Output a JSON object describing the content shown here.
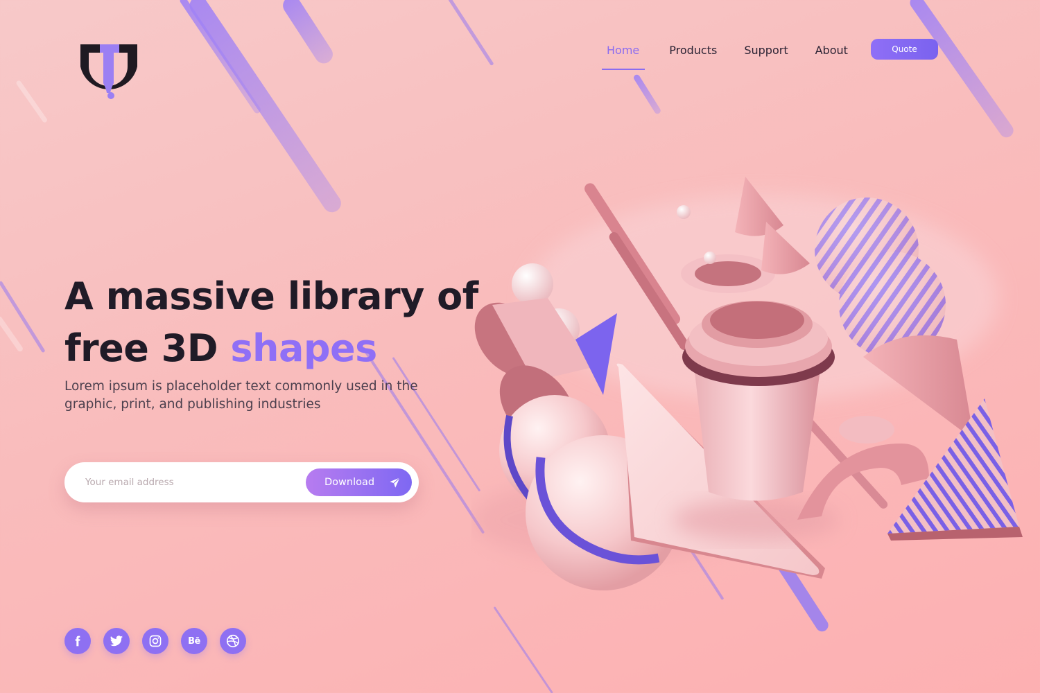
{
  "brand": {
    "logo_icon": "brand-logo-icon",
    "colors": {
      "accent": "#8f6ff6",
      "dark": "#201b27",
      "background": "#f9bcbc"
    }
  },
  "nav": {
    "items": [
      {
        "label": "Home",
        "active": true
      },
      {
        "label": "Products",
        "active": false
      },
      {
        "label": "Support",
        "active": false
      },
      {
        "label": "About",
        "active": false
      }
    ],
    "cta_label": "Quote"
  },
  "hero": {
    "headline_line1": "A massive library of",
    "headline_line2_plain": "free 3D ",
    "headline_line2_accent": "shapes",
    "subtext": "Lorem ipsum is placeholder text commonly used in the graphic, print, and publishing industries"
  },
  "signup": {
    "email_placeholder": "Your email address",
    "email_value": "",
    "download_label": "Download",
    "button_icon": "paper-plane-icon"
  },
  "social": [
    {
      "name": "facebook",
      "icon": "facebook-icon"
    },
    {
      "name": "twitter",
      "icon": "twitter-icon"
    },
    {
      "name": "instagram",
      "icon": "instagram-icon"
    },
    {
      "name": "behance",
      "icon": "behance-icon",
      "glyph": "Bē"
    },
    {
      "name": "dribbble",
      "icon": "dribbble-icon"
    }
  ]
}
